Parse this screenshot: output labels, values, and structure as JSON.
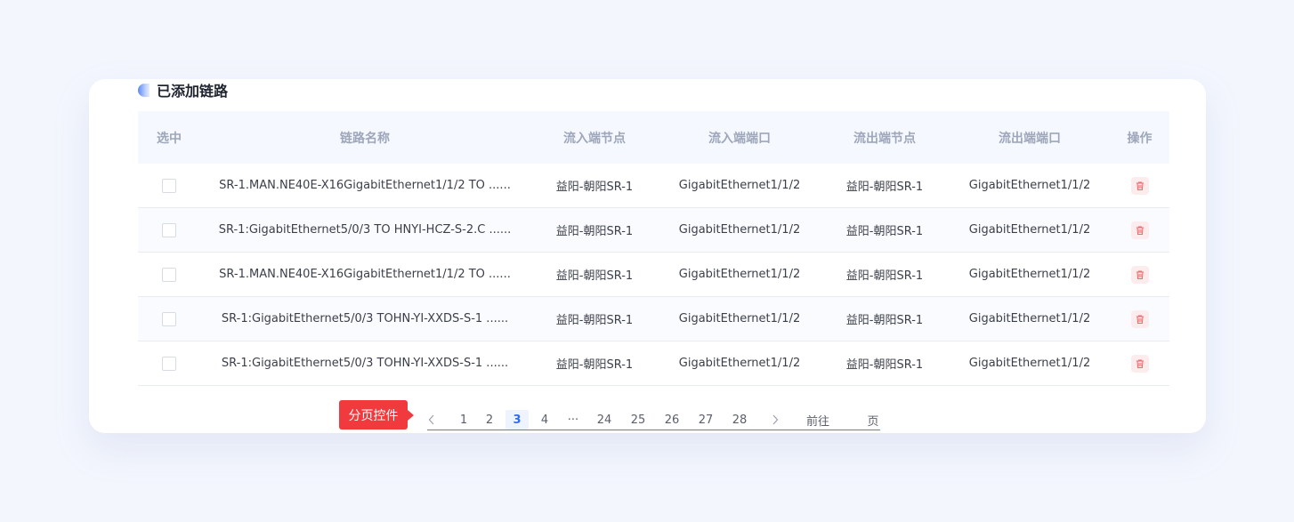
{
  "section": {
    "title": "已添加链路"
  },
  "table": {
    "headers": [
      "选中",
      "链路名称",
      "流入端节点",
      "流入端端口",
      "流出端节点",
      "流出端端口",
      "操作"
    ],
    "rows": [
      {
        "name": "SR-1.MAN.NE40E-X16GigabitEthernet1/1/2 TO ......",
        "in_node": "益阳-朝阳SR-1",
        "in_port": "GigabitEthernet1/1/2",
        "out_node": "益阳-朝阳SR-1",
        "out_port": "GigabitEthernet1/1/2"
      },
      {
        "name": "SR-1:GigabitEthernet5/0/3 TO HNYI-HCZ-S-2.C ......",
        "in_node": "益阳-朝阳SR-1",
        "in_port": "GigabitEthernet1/1/2",
        "out_node": "益阳-朝阳SR-1",
        "out_port": "GigabitEthernet1/1/2"
      },
      {
        "name": "SR-1.MAN.NE40E-X16GigabitEthernet1/1/2 TO ......",
        "in_node": "益阳-朝阳SR-1",
        "in_port": "GigabitEthernet1/1/2",
        "out_node": "益阳-朝阳SR-1",
        "out_port": "GigabitEthernet1/1/2"
      },
      {
        "name": "SR-1:GigabitEthernet5/0/3 TOHN-YI-XXDS-S-1 ......",
        "in_node": "益阳-朝阳SR-1",
        "in_port": "GigabitEthernet1/1/2",
        "out_node": "益阳-朝阳SR-1",
        "out_port": "GigabitEthernet1/1/2"
      },
      {
        "name": "SR-1:GigabitEthernet5/0/3 TOHN-YI-XXDS-S-1 ......",
        "in_node": "益阳-朝阳SR-1",
        "in_port": "GigabitEthernet1/1/2",
        "out_node": "益阳-朝阳SR-1",
        "out_port": "GigabitEthernet1/1/2"
      }
    ]
  },
  "callout": {
    "label": "分页控件"
  },
  "pagination": {
    "prev": "<",
    "pages": [
      "1",
      "2",
      "3",
      "4",
      "···",
      "24",
      "25",
      "26",
      "27",
      "28"
    ],
    "active": "3",
    "next": ">",
    "goto_prefix": "前往",
    "goto_suffix": "页",
    "goto_value": ""
  },
  "colors": {
    "accent": "#2f6df0",
    "callout": "#f03a3d",
    "delete": "#f06b6e"
  }
}
